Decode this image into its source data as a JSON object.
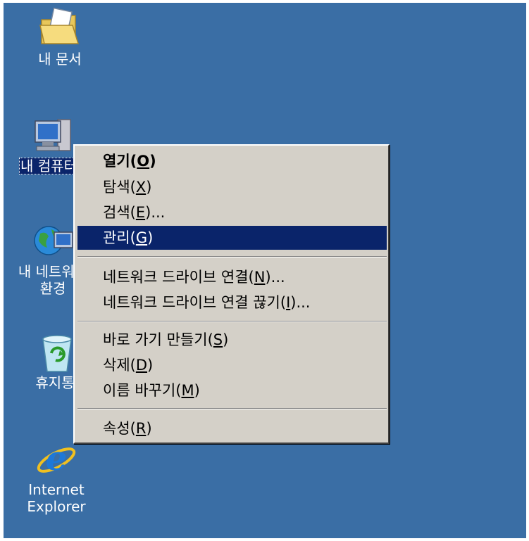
{
  "desktop": {
    "background": "#3a6ea5",
    "icons": [
      {
        "label": "내 문서",
        "icon": "folder-documents-icon"
      },
      {
        "label": "내 컴퓨터",
        "icon": "my-computer-icon"
      },
      {
        "label": "내 네트워크 환경",
        "icon": "network-places-icon"
      },
      {
        "label": "휴지통",
        "icon": "recycle-bin-icon"
      },
      {
        "label": "Internet Explorer",
        "icon": "internet-explorer-icon"
      }
    ]
  },
  "context_menu": {
    "highlight_color": "#0a246a",
    "items": [
      {
        "label": "열기(O)",
        "base": "열기(",
        "key": "O",
        "tail": ")",
        "bold": true
      },
      {
        "label": "탐색(X)",
        "base": "탐색(",
        "key": "X",
        "tail": ")"
      },
      {
        "label": "검색(E)...",
        "base": "검색(",
        "key": "E",
        "tail": ")..."
      },
      {
        "label": "관리(G)",
        "base": "관리(",
        "key": "G",
        "tail": ")",
        "highlighted": true
      },
      {
        "label": "네트워크 드라이브 연결(N)...",
        "base": "네트워크 드라이브 연결(",
        "key": "N",
        "tail": ")..."
      },
      {
        "label": "네트워크 드라이브 연결 끊기(I)...",
        "base": "네트워크 드라이브 연결 끊기(",
        "key": "I",
        "tail": ")..."
      },
      {
        "label": "바로 가기 만들기(S)",
        "base": "바로 가기 만들기(",
        "key": "S",
        "tail": ")"
      },
      {
        "label": "삭제(D)",
        "base": "삭제(",
        "key": "D",
        "tail": ")"
      },
      {
        "label": "이름 바꾸기(M)",
        "base": "이름 바꾸기(",
        "key": "M",
        "tail": ")"
      },
      {
        "label": "속성(R)",
        "base": "속성(",
        "key": "R",
        "tail": ")"
      }
    ]
  }
}
